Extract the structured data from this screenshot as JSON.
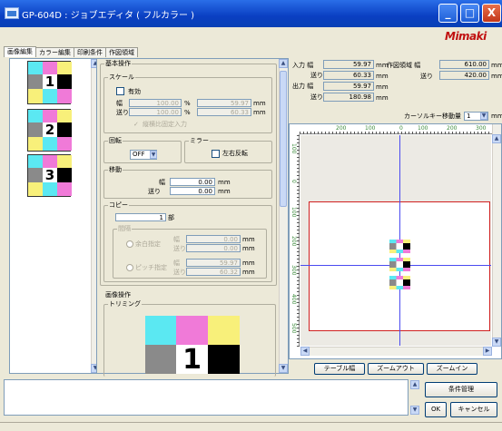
{
  "window": {
    "title": "GP-604D : ジョブエディタ ( フルカラー )",
    "min": "_",
    "max": "□",
    "close": "X",
    "logo": "Mimaki"
  },
  "tabs": [
    "画像編集",
    "カラー編集",
    "印刷条件",
    "作図領域"
  ],
  "thumbnails": [
    "1",
    "2",
    "3"
  ],
  "basic": {
    "title": "基本操作",
    "scale": {
      "title": "スケール",
      "enable": "有効",
      "w_label": "幅",
      "h_label": "送り",
      "w_pct": "100.00",
      "h_pct": "100.00",
      "pct": "%",
      "w_mm": "59.97",
      "h_mm": "60.33",
      "mm": "mm",
      "keep_ratio": "縦横比固定入力"
    },
    "rotate": {
      "title": "回転",
      "value": "OFF"
    },
    "mirror": {
      "title": "ミラー",
      "lr": "左右反転"
    },
    "move": {
      "title": "移動",
      "w_label": "幅",
      "h_label": "送り",
      "w": "0.00",
      "h": "0.00",
      "mm": "mm"
    },
    "copy": {
      "title": "コピー",
      "count": "1",
      "unit": "部",
      "spacing": "間隔",
      "blank": "余白指定",
      "pitch": "ピッチ指定",
      "b_w_label": "幅",
      "b_h_label": "送り",
      "b_w": "0.00",
      "b_h": "0.00",
      "p_w_label": "幅",
      "p_h_label": "送り",
      "p_w": "59.97",
      "p_h": "60.32",
      "mm": "mm"
    }
  },
  "image_op": {
    "title": "画像操作",
    "trim": "トリミング"
  },
  "info": {
    "in_w_label": "入力 幅",
    "in_h_label": "送り",
    "in_w": "59.97",
    "in_h": "60.33",
    "out_w_label": "出力 幅",
    "out_h_label": "送り",
    "out_w": "59.97",
    "out_h": "180.98",
    "mm": "mm",
    "area_w_label": "作図領域 幅",
    "area_h_label": "送り",
    "area_w": "610.00",
    "area_h": "420.00"
  },
  "cursor": {
    "label": "カーソルキー移動量",
    "value": "1",
    "unit": "mm"
  },
  "ruler_top": [
    "200",
    "100",
    "0",
    "100",
    "200",
    "300"
  ],
  "ruler_left": [
    "100",
    "0",
    "100",
    "200",
    "300",
    "400",
    "500"
  ],
  "buttons": {
    "table_width": "テーブル幅",
    "zoom_out": "ズームアウト",
    "zoom_in": "ズームイン",
    "conditions": "条件管理",
    "ok": "OK",
    "cancel": "キャンセル"
  },
  "colors": {
    "title": "#0a3fc2",
    "cyan": "#5be8f2",
    "magenta": "#f07ad8",
    "yellow": "#f8f07a",
    "gray": "#8a8a8a"
  }
}
